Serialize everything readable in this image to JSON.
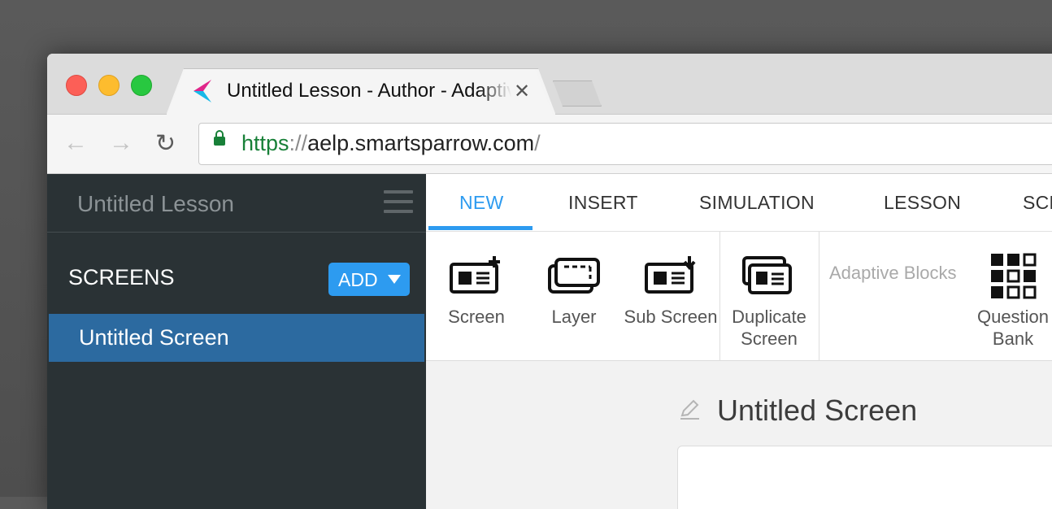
{
  "browser": {
    "tab_title": "Untitled Lesson - Author - Adaptive eLearning Platform",
    "tab_close": "✕",
    "url_scheme": "https",
    "url_sep": "://",
    "url_host": "aelp.smartsparrow.com",
    "url_trail": "/",
    "nav_back": "←",
    "nav_forward": "→",
    "nav_reload": "↻"
  },
  "sidebar": {
    "lesson_title": "Untitled Lesson",
    "screens_label": "SCREENS",
    "add_label": "ADD",
    "screens": [
      {
        "label": "Untitled Screen",
        "selected": true
      }
    ]
  },
  "ribbon_tabs": [
    {
      "label": "NEW",
      "active": true
    },
    {
      "label": "INSERT"
    },
    {
      "label": "SIMULATION"
    },
    {
      "label": "LESSON"
    },
    {
      "label": "SCREEN"
    }
  ],
  "ribbon_items": {
    "screen": "Screen",
    "layer": "Layer",
    "sub_screen": "Sub Screen",
    "duplicate_screen": "Duplicate Screen",
    "adaptive_blocks": "Adaptive Blocks",
    "question_bank": "Question Bank"
  },
  "content": {
    "screen_title": "Untitled Screen"
  },
  "colors": {
    "accent": "#2d9bf0",
    "sidebar_bg": "#2a3235",
    "selected_item": "#2c6aa0",
    "secure_green": "#188038"
  }
}
